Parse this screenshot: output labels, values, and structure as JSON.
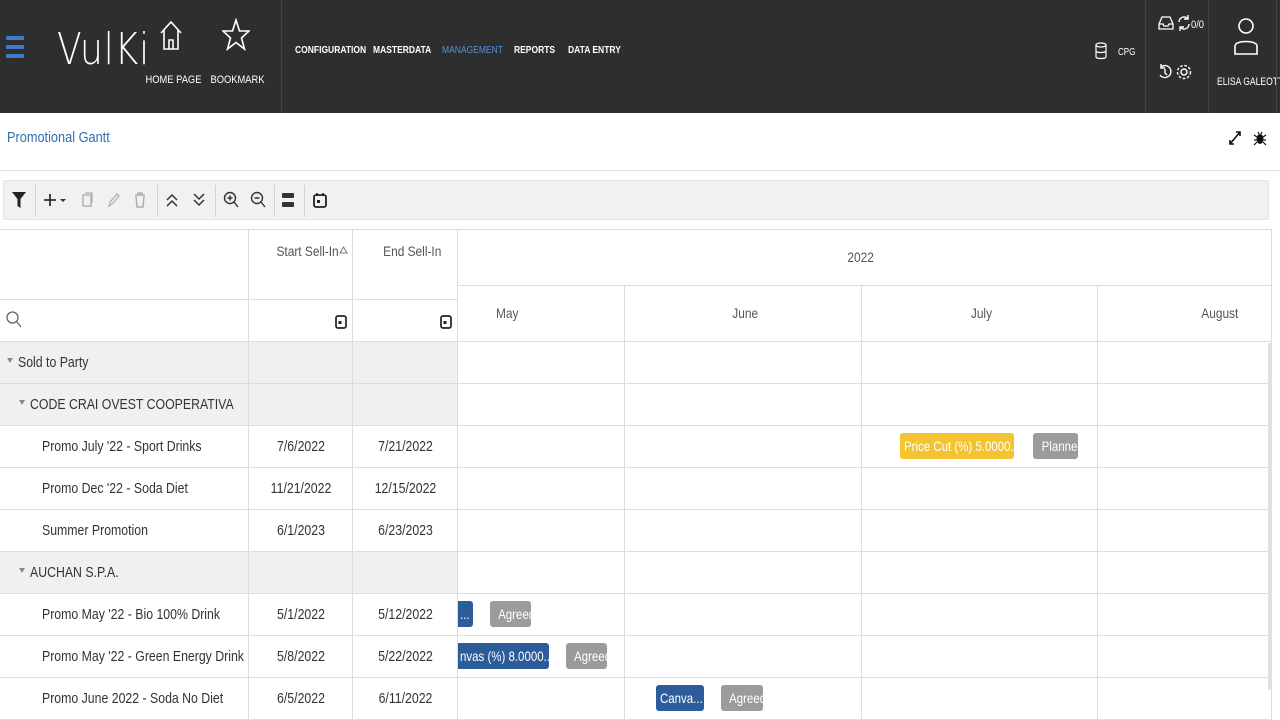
{
  "header": {
    "logo": "VulKi",
    "home_label": "HOME PAGE",
    "bookmark_label": "BOOKMARK",
    "menu": [
      "CONFIGURATION",
      "MASTERDATA",
      "MANAGEMENT",
      "REPORTS",
      "DATA ENTRY"
    ],
    "active_menu": "MANAGEMENT",
    "db_label": "CPG",
    "counter": "0/0",
    "user_name": "ELISA GALEOTTI"
  },
  "page": {
    "title": "Promotional Gantt"
  },
  "grid": {
    "col_start": "Start Sell-In",
    "col_end": "End Sell-In",
    "year": "2022",
    "months": [
      "May",
      "June",
      "July",
      "August"
    ],
    "rows": [
      {
        "type": "group",
        "level": 0,
        "label": "Sold to Party"
      },
      {
        "type": "group",
        "level": 1,
        "label": "CODE CRAI OVEST COOPERATIVA"
      },
      {
        "type": "item",
        "label": "Promo July '22 - Sport Drinks",
        "start": "7/6/2022",
        "end": "7/21/2022",
        "bar": "Price Cut (%) 5.0000...",
        "status": "Planned"
      },
      {
        "type": "item",
        "label": "Promo Dec '22 - Soda Diet",
        "start": "11/21/2022",
        "end": "12/15/2022"
      },
      {
        "type": "item",
        "label": "Summer Promotion",
        "start": "6/1/2023",
        "end": "6/23/2023"
      },
      {
        "type": "group",
        "level": 1,
        "label": "AUCHAN S.P.A."
      },
      {
        "type": "item",
        "label": "Promo May '22 - Bio 100% Drink",
        "start": "5/1/2022",
        "end": "5/12/2022",
        "bar": "...",
        "status": "Agreed"
      },
      {
        "type": "item",
        "label": "Promo May '22 - Green Energy Drink",
        "start": "5/8/2022",
        "end": "5/22/2022",
        "bar": "nvas (%) 8.0000...",
        "status": "Agreed"
      },
      {
        "type": "item",
        "label": "Promo June 2022 - Soda No Diet",
        "start": "6/5/2022",
        "end": "6/11/2022",
        "bar": "Canva...",
        "status": "Agreed"
      }
    ]
  },
  "colors": {
    "accent": "#2f6db5",
    "bar_blue": "#2c5c9a",
    "bar_yellow": "#f4c430",
    "status_gray": "#9b9b9b",
    "header_bg": "#2e2e2e"
  }
}
